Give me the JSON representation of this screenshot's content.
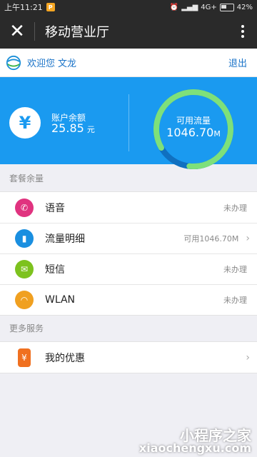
{
  "status_bar": {
    "time": "上午11:21",
    "app_badge": "P",
    "network": "4G+",
    "battery": "42%",
    "battery_level": 0.42
  },
  "app_bar": {
    "title": "移动营业厅"
  },
  "welcome": {
    "greeting": "欢迎您",
    "name": "文龙",
    "logout": "退出"
  },
  "account": {
    "balance_label": "账户余额",
    "balance": "25.85",
    "balance_unit": "元",
    "currency_icon": "¥"
  },
  "data_usage": {
    "label": "可用流量",
    "value": "1046.70",
    "unit": "M",
    "ring_fraction": 0.85
  },
  "sections": {
    "plan_remaining": "套餐余量",
    "more_services": "更多服务"
  },
  "plan_items": [
    {
      "label": "语音",
      "status": "未办理",
      "icon": "phone-icon",
      "color": "#e0337f"
    },
    {
      "label": "流量明细",
      "status": "可用1046.70M",
      "icon": "data-bars-icon",
      "color": "#1a8fe0",
      "has_chevron": true
    },
    {
      "label": "短信",
      "status": "未办理",
      "icon": "envelope-icon",
      "color": "#7dc21e"
    },
    {
      "label": "WLAN",
      "status": "未办理",
      "icon": "wifi-icon",
      "color": "#f0a020"
    }
  ],
  "service_items": [
    {
      "label": "我的优惠",
      "icon": "coupon-icon",
      "color": "#f07020",
      "has_chevron": true
    }
  ],
  "watermark": {
    "cn": "小程序之家",
    "en": "xiaochengxu.com"
  }
}
